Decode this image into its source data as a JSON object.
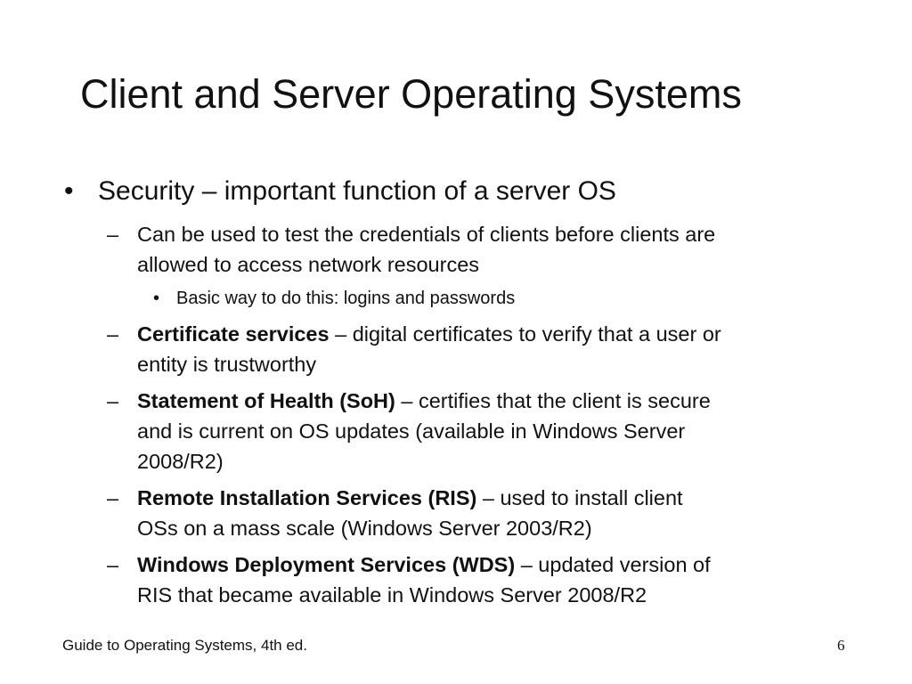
{
  "slide": {
    "title": "Client and Server Operating Systems",
    "bullet_mark": "•",
    "sub_mark": "–",
    "bullets": {
      "security": {
        "text": "Security – important function of a server OS"
      },
      "credentials": {
        "line1": "Can be used to test the credentials of clients before clients are",
        "line2": "allowed to access network resources"
      },
      "logins": {
        "text": "Basic way to do this: logins and passwords"
      },
      "certificate": {
        "term": "Certificate services",
        "line1_rest": " – digital certificates to verify that a user or",
        "line2": "entity is trustworthy"
      },
      "soh": {
        "term": "Statement of Health (SoH)",
        "line1_rest": " – certifies that the client is secure",
        "line2": "and is current on OS updates (available in Windows Server",
        "line3": "2008/R2)"
      },
      "ris": {
        "term": "Remote Installation Services (RIS)",
        "line1_rest": " – used to install client",
        "line2": "OSs on a mass scale (Windows Server 2003/R2)"
      },
      "wds": {
        "term": "Windows Deployment Services (WDS)",
        "line1_rest": " – updated version of",
        "line2": "RIS that became available in Windows Server 2008/R2"
      }
    }
  },
  "footer": {
    "book": "Guide to Operating Systems, 4th ed.",
    "page_number": "6"
  }
}
